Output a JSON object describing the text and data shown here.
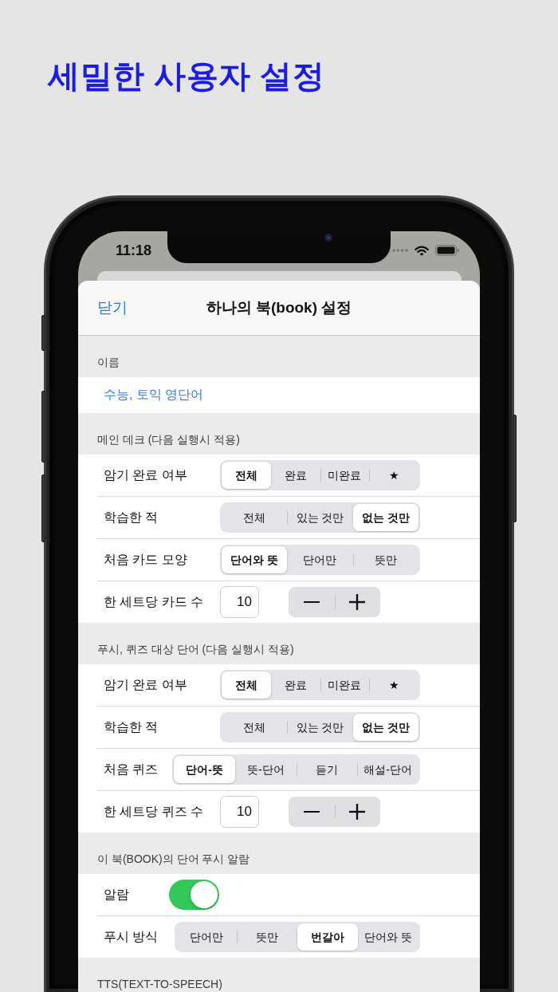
{
  "headline": "세밀한 사용자 설정",
  "status_bar": {
    "time": "11:18"
  },
  "nav_bar": {
    "close_button": "닫기",
    "title": "하나의 북(book) 설정"
  },
  "sections": [
    {
      "header": "이름",
      "rows": [
        {
          "kind": "text_field",
          "value": "수능, 토익 영단어"
        }
      ]
    },
    {
      "header": "메인 데크 (다음 실행시 적용)",
      "rows": [
        {
          "kind": "segmented",
          "label": "암기 완료 여부",
          "segments": [
            {
              "label": "전체",
              "selected": true
            },
            {
              "label": "완료",
              "selected": false
            },
            {
              "label": "미완료",
              "selected": false
            },
            {
              "label": "★",
              "selected": false
            }
          ]
        },
        {
          "kind": "segmented",
          "label": "학습한 적",
          "segments": [
            {
              "label": "전체",
              "selected": false
            },
            {
              "label": "있는 것만",
              "selected": false
            },
            {
              "label": "없는 것만",
              "selected": true
            }
          ]
        },
        {
          "kind": "segmented",
          "label": "처음 카드 모양",
          "segments": [
            {
              "label": "단어와 뜻",
              "selected": true
            },
            {
              "label": "단어만",
              "selected": false
            },
            {
              "label": "뜻만",
              "selected": false
            }
          ]
        },
        {
          "kind": "stepper",
          "label": "한 세트당 카드 수",
          "value": "10"
        }
      ]
    },
    {
      "header": "푸시, 퀴즈 대상 단어 (다음 실행시 적용)",
      "rows": [
        {
          "kind": "segmented",
          "label": "암기 완료 여부",
          "segments": [
            {
              "label": "전체",
              "selected": true
            },
            {
              "label": "완료",
              "selected": false
            },
            {
              "label": "미완료",
              "selected": false
            },
            {
              "label": "★",
              "selected": false
            }
          ]
        },
        {
          "kind": "segmented",
          "label": "학습한 적",
          "segments": [
            {
              "label": "전체",
              "selected": false
            },
            {
              "label": "있는 것만",
              "selected": false
            },
            {
              "label": "없는 것만",
              "selected": true
            }
          ]
        },
        {
          "kind": "segmented",
          "label": "처음 퀴즈",
          "segments": [
            {
              "label": "단어-뜻",
              "selected": true
            },
            {
              "label": "뜻-단어",
              "selected": false
            },
            {
              "label": "듣기",
              "selected": false
            },
            {
              "label": "해설-단어",
              "selected": false
            }
          ]
        },
        {
          "kind": "stepper",
          "label": "한 세트당 퀴즈 수",
          "value": "10"
        }
      ]
    },
    {
      "header": "이 북(BOOK)의 단어 푸시 알람",
      "rows": [
        {
          "kind": "toggle",
          "label": "알람",
          "on": true
        },
        {
          "kind": "segmented",
          "label": "푸시 방식",
          "segments": [
            {
              "label": "단어만",
              "selected": false
            },
            {
              "label": "뜻만",
              "selected": false
            },
            {
              "label": "번갈아",
              "selected": true
            },
            {
              "label": "단어와 뜻",
              "selected": false
            }
          ]
        }
      ]
    },
    {
      "header": "TTS(TEXT-TO-SPEECH)"
    }
  ]
}
